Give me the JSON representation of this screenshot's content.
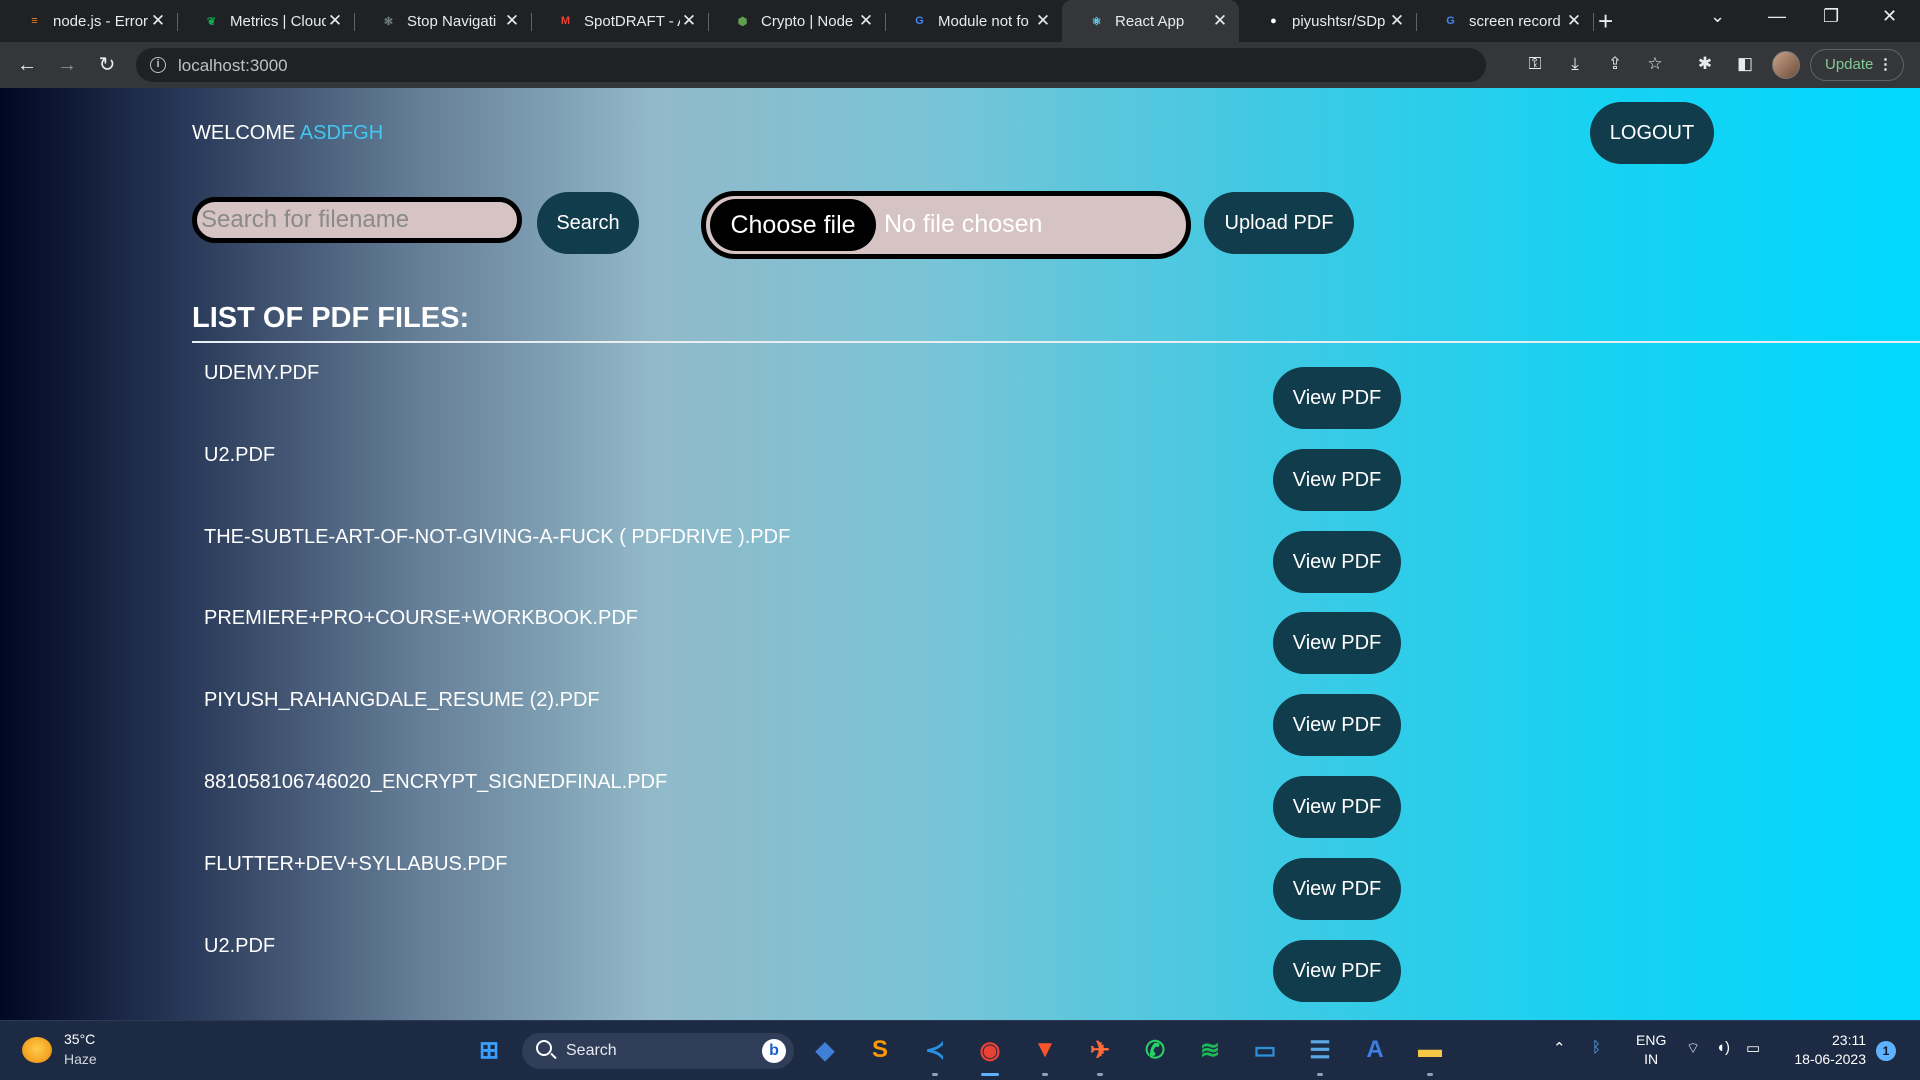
{
  "browser": {
    "tabs": [
      {
        "title": "node.js - Error",
        "fav": "stack-icon",
        "color": "#f48024",
        "glyph": "≡",
        "active": false
      },
      {
        "title": "Metrics | Cloud",
        "fav": "mongodb-leaf-icon",
        "color": "#13aa52",
        "glyph": "❦",
        "active": false
      },
      {
        "title": "Stop Navigati",
        "fav": "chatgpt-icon",
        "color": "#6e7f77",
        "glyph": "✻",
        "active": false
      },
      {
        "title": "SpotDRAFT - A",
        "fav": "gmail-icon",
        "color": "#ea4335",
        "glyph": "M",
        "active": false
      },
      {
        "title": "Crypto | Node",
        "fav": "nodejs-hexagon-icon",
        "color": "#5fa04e",
        "glyph": "⬢",
        "active": false
      },
      {
        "title": "Module not fo",
        "fav": "google-icon",
        "color": "#4285f4",
        "glyph": "G",
        "active": false
      },
      {
        "title": "React App",
        "fav": "react-icon",
        "color": "#61dafb",
        "glyph": "⚛",
        "active": true
      },
      {
        "title": "piyushtsr/SDp",
        "fav": "github-icon",
        "color": "#ffffff",
        "glyph": "●",
        "active": false
      },
      {
        "title": "screen record",
        "fav": "google-icon",
        "color": "#4285f4",
        "glyph": "G",
        "active": false
      }
    ],
    "url": "localhost:3000",
    "update_label": "Update"
  },
  "app": {
    "welcome_prefix": "WELCOME",
    "username": "ASDFGH",
    "logout_label": "LOGOUT",
    "search": {
      "placeholder": "Search for filename",
      "value": "",
      "button": "Search"
    },
    "upload": {
      "choose_label": "Choose file",
      "status": "No file chosen",
      "button": "Upload PDF"
    },
    "list_title": "LIST OF PDF FILES:",
    "view_label": "View PDF",
    "files": [
      "UDEMY.PDF",
      "U2.PDF",
      "THE-SUBTLE-ART-OF-NOT-GIVING-A-FUCK ( PDFDRIVE ).PDF",
      "PREMIERE+PRO+COURSE+WORKBOOK.PDF",
      "PIYUSH_RAHANGDALE_RESUME (2).PDF",
      "881058106746020_ENCRYPT_SIGNEDFINAL.PDF",
      "FLUTTER+DEV+SYLLABUS.PDF",
      "U2.PDF"
    ]
  },
  "taskbar": {
    "weather_temp": "35°C",
    "weather_desc": "Haze",
    "search_label": "Search",
    "lang_top": "ENG",
    "lang_bottom": "IN",
    "time": "23:11",
    "date": "18-06-2023",
    "notifications": "1",
    "apps": [
      {
        "name": "windows-start-icon",
        "color": "#3aa0ff",
        "glyph": "⊞"
      },
      {
        "name": "git-icon",
        "color": "#3f7fd6",
        "glyph": "◆"
      },
      {
        "name": "sublime-text-icon",
        "color": "#ff9800",
        "glyph": "S"
      },
      {
        "name": "vscode-icon",
        "color": "#2b8fe0",
        "glyph": "≺"
      },
      {
        "name": "chrome-icon",
        "color": "#e94235",
        "glyph": "◉"
      },
      {
        "name": "brave-icon",
        "color": "#fb542b",
        "glyph": "▼"
      },
      {
        "name": "postman-icon",
        "color": "#ff6c37",
        "glyph": "✈"
      },
      {
        "name": "whatsapp-icon",
        "color": "#25d366",
        "glyph": "✆"
      },
      {
        "name": "spotify-icon",
        "color": "#1db954",
        "glyph": "≋"
      },
      {
        "name": "desktop-icon",
        "color": "#2d8fd8",
        "glyph": "▭"
      },
      {
        "name": "notepad-icon",
        "color": "#5ba8e6",
        "glyph": "☰"
      },
      {
        "name": "appstore-icon",
        "color": "#3d7ee0",
        "glyph": "A"
      },
      {
        "name": "file-explorer-icon",
        "color": "#f6c744",
        "glyph": "▬"
      }
    ]
  }
}
